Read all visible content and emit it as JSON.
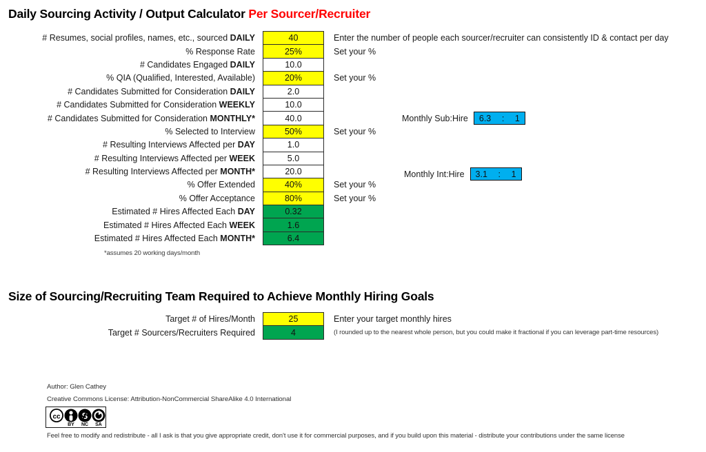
{
  "titles": {
    "main_black": "Daily Sourcing Activity / Output Calculator ",
    "main_red": "Per Sourcer/Recruiter",
    "team": "Size of Sourcing/Recruiting Team Required to Achieve Monthly Hiring Goals"
  },
  "colors": {
    "input_yellow": "#FFFF00",
    "result_green": "#00A550",
    "ratio_blue": "#00AFEF",
    "accent_red": "#FF0000",
    "border": "#2b2b2b"
  },
  "calculator_rows": [
    {
      "label_plain": "# Resumes, social profiles, names, etc., sourced ",
      "label_bold": "DAILY",
      "value": "40",
      "fill": "yellow",
      "note": "Enter the number of people each sourcer/recruiter can consistently ID & contact per day"
    },
    {
      "label_plain": "% Response Rate",
      "label_bold": "",
      "value": "25%",
      "fill": "yellow",
      "note": "Set your %"
    },
    {
      "label_plain": "# Candidates Engaged ",
      "label_bold": "DAILY",
      "value": "10.0",
      "fill": "white",
      "note": ""
    },
    {
      "label_plain": "% QIA (Qualified, Interested, Available)",
      "label_bold": "",
      "value": "20%",
      "fill": "yellow",
      "note": "Set your %"
    },
    {
      "label_plain": "# Candidates Submitted for Consideration ",
      "label_bold": "DAILY",
      "value": "2.0",
      "fill": "white",
      "note": ""
    },
    {
      "label_plain": "# Candidates Submitted for Consideration ",
      "label_bold": "WEEKLY",
      "value": "10.0",
      "fill": "white",
      "note": ""
    },
    {
      "label_plain": "# Candidates Submitted for Consideration ",
      "label_bold": "MONTHLY*",
      "value": "40.0",
      "fill": "white",
      "note": ""
    },
    {
      "label_plain": "% Selected to Interview",
      "label_bold": "",
      "value": "50%",
      "fill": "yellow",
      "note": "Set your %"
    },
    {
      "label_plain": "# Resulting Interviews Affected per ",
      "label_bold": "DAY",
      "value": "1.0",
      "fill": "white",
      "note": ""
    },
    {
      "label_plain": "# Resulting Interviews Affected per ",
      "label_bold": "WEEK",
      "value": "5.0",
      "fill": "white",
      "note": ""
    },
    {
      "label_plain": "# Resulting Interviews Affected per ",
      "label_bold": "MONTH*",
      "value": "20.0",
      "fill": "white",
      "note": ""
    },
    {
      "label_plain": "% Offer Extended",
      "label_bold": "",
      "value": "40%",
      "fill": "yellow",
      "note": "Set your %"
    },
    {
      "label_plain": "% Offer Acceptance",
      "label_bold": "",
      "value": "80%",
      "fill": "yellow",
      "note": "Set your %"
    },
    {
      "label_plain": "Estimated # Hires Affected Each ",
      "label_bold": "DAY",
      "value": "0.32",
      "fill": "green",
      "note": ""
    },
    {
      "label_plain": "Estimated # Hires Affected Each ",
      "label_bold": "WEEK",
      "value": "1.6",
      "fill": "green",
      "note": ""
    },
    {
      "label_plain": "Estimated # Hires Affected Each ",
      "label_bold": "MONTH*",
      "value": "6.4",
      "fill": "green",
      "note": ""
    }
  ],
  "ratios": [
    {
      "label": "Monthly Sub:Hire",
      "numerator": "6.3",
      "separator": ":",
      "denominator": "1"
    },
    {
      "label": "Monthly Int:Hire",
      "numerator": "3.1",
      "separator": ":",
      "denominator": "1"
    }
  ],
  "footnote": "*assumes 20 working days/month",
  "team_rows": [
    {
      "label_plain": "Target # of Hires/Month",
      "label_bold": "",
      "value": "25",
      "fill": "yellow",
      "note": "Enter your target monthly hires",
      "note_tiny": false
    },
    {
      "label_plain": "Target # Sourcers/Recruiters Required",
      "label_bold": "",
      "value": "4",
      "fill": "green",
      "note": "(I rounded up to the nearest whole person, but you could make it fractional if you can leverage part-time resources)",
      "note_tiny": true
    }
  ],
  "footer": {
    "author": "Author: Glen Cathey",
    "license": "Creative Commons License: Attribution-NonCommercial ShareAlike 4.0 International",
    "terms": "Feel free to modify and redistribute - all I ask is that you give appropriate credit, don't use it for commercial purposes, and if you build upon this material - distribute your contributions under the same license",
    "badge": {
      "cc": "cc",
      "by": "BY",
      "nc": "NC",
      "sa": "SA"
    }
  }
}
